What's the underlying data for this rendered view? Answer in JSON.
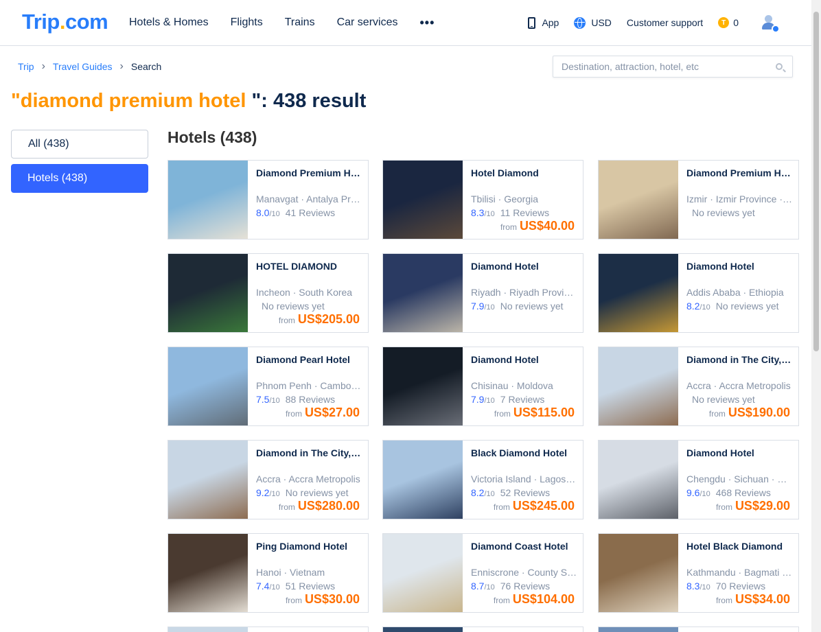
{
  "header": {
    "logo_main": "Trip",
    "logo_dot": ".",
    "logo_tld": "com",
    "nav": [
      "Hotels & Homes",
      "Flights",
      "Trains",
      "Car services"
    ],
    "more": "•••",
    "app_label": "App",
    "currency": "USD",
    "support": "Customer support",
    "coins": "0",
    "coin_letter": "T"
  },
  "breadcrumb": [
    {
      "label": "Trip"
    },
    {
      "label": "Travel Guides"
    },
    {
      "label": "Search"
    }
  ],
  "search": {
    "placeholder": "Destination, attraction, hotel, etc"
  },
  "result": {
    "q_open": "\"",
    "keyword": "diamond premium hotel",
    "q_close": " \": 438 result"
  },
  "sidebar": {
    "all": "All (438)",
    "hotels": "Hotels (438)"
  },
  "section_title": "Hotels (438)",
  "hotels": [
    {
      "name": "Diamond Premium Hotel & Spa",
      "location": "Manavgat · Antalya Province",
      "score": "8.0",
      "of": "/10",
      "reviews": "41 Reviews",
      "from": "",
      "price": "",
      "colors": [
        "#7fb4d8",
        "#e8e2d6"
      ]
    },
    {
      "name": "Hotel Diamond",
      "location": "Tbilisi · Georgia",
      "score": "8.3",
      "of": "/10",
      "reviews": "11 Reviews",
      "from": "from",
      "price": "US$40.00",
      "colors": [
        "#1a2640",
        "#5d4a3a"
      ]
    },
    {
      "name": "Diamond Premium Hotel",
      "location": "Izmir · Izmir Province · Turkey",
      "score": "",
      "of": "",
      "reviews": "No reviews yet",
      "from": "",
      "price": "",
      "colors": [
        "#d8c6a4",
        "#7e6650"
      ]
    },
    {
      "name": "HOTEL DIAMOND",
      "location": "Incheon · South Korea",
      "score": "",
      "of": "",
      "reviews": "No reviews yet",
      "from": "from",
      "price": "US$205.00",
      "colors": [
        "#1e2a36",
        "#3b7a3a"
      ]
    },
    {
      "name": "Diamond Hotel",
      "location": "Riyadh · Riyadh Province",
      "score": "7.9",
      "of": "/10",
      "reviews": "No reviews yet",
      "from": "",
      "price": "",
      "colors": [
        "#2a3a62",
        "#bfb8aa"
      ]
    },
    {
      "name": "Diamond Hotel",
      "location": "Addis Ababa · Ethiopia",
      "score": "8.2",
      "of": "/10",
      "reviews": "No reviews yet",
      "from": "",
      "price": "",
      "colors": [
        "#1c2e46",
        "#c99a34"
      ]
    },
    {
      "name": "Diamond Pearl Hotel",
      "location": "Phnom Penh · Cambodia",
      "score": "7.5",
      "of": "/10",
      "reviews": "88 Reviews",
      "from": "from",
      "price": "US$27.00",
      "colors": [
        "#8fb8de",
        "#5f6a74"
      ]
    },
    {
      "name": "Diamond Hotel",
      "location": "Chisinau · Moldova",
      "score": "7.9",
      "of": "/10",
      "reviews": "7 Reviews",
      "from": "from",
      "price": "US$115.00",
      "colors": [
        "#141c26",
        "#6b6f78"
      ]
    },
    {
      "name": "Diamond in The City, Accra",
      "location": "Accra · Accra Metropolis",
      "score": "",
      "of": "",
      "reviews": "No reviews yet",
      "from": "from",
      "price": "US$190.00",
      "colors": [
        "#c8d6e4",
        "#8c6a4e"
      ]
    },
    {
      "name": "Diamond in The City, Accra",
      "location": "Accra · Accra Metropolis",
      "score": "9.2",
      "of": "/10",
      "reviews": "No reviews yet",
      "from": "from",
      "price": "US$280.00",
      "colors": [
        "#c8d6e4",
        "#8c6a4e"
      ]
    },
    {
      "name": "Black Diamond Hotel",
      "location": "Victoria Island · Lagos · Nigeria",
      "score": "8.2",
      "of": "/10",
      "reviews": "52 Reviews",
      "from": "from",
      "price": "US$245.00",
      "colors": [
        "#a8c4e0",
        "#2c3e5e"
      ]
    },
    {
      "name": "Diamond Hotel",
      "location": "Chengdu · Sichuan · China",
      "score": "9.6",
      "of": "/10",
      "reviews": "468 Reviews",
      "from": "from",
      "price": "US$29.00",
      "colors": [
        "#d6dce4",
        "#5a5e66"
      ]
    },
    {
      "name": "Ping Diamond Hotel",
      "location": "Hanoi · Vietnam",
      "score": "7.4",
      "of": "/10",
      "reviews": "51 Reviews",
      "from": "from",
      "price": "US$30.00",
      "colors": [
        "#4a3a30",
        "#e6e0d6"
      ]
    },
    {
      "name": "Diamond Coast Hotel",
      "location": "Enniscrone · County Sligo",
      "score": "8.7",
      "of": "/10",
      "reviews": "76 Reviews",
      "from": "from",
      "price": "US$104.00",
      "colors": [
        "#dfe6ec",
        "#c8b48a"
      ]
    },
    {
      "name": "Hotel Black Diamond",
      "location": "Kathmandu · Bagmati Province",
      "score": "8.3",
      "of": "/10",
      "reviews": "70 Reviews",
      "from": "from",
      "price": "US$34.00",
      "colors": [
        "#8a6c4c",
        "#e0d4c0"
      ]
    }
  ],
  "partial_colors": [
    "#c9d8e6",
    "#2f4a6c",
    "#6f8fb8"
  ],
  "accent": "#3264ff",
  "price_color": "#ff6f00",
  "keyword_color": "#ff9500"
}
